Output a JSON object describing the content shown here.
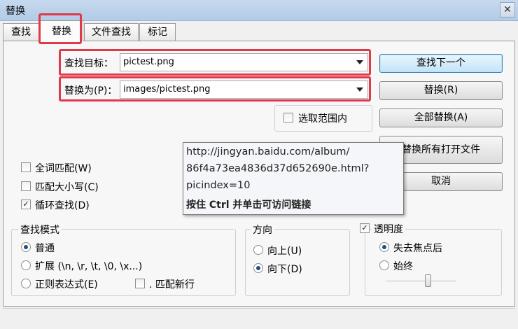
{
  "window": {
    "title": "替换",
    "close_glyph": "✕"
  },
  "tabs": [
    {
      "label": "查找"
    },
    {
      "label": "替换"
    },
    {
      "label": "文件查找"
    },
    {
      "label": "标记"
    }
  ],
  "find": {
    "label": "查找目标：",
    "value": "pictest.png"
  },
  "replace": {
    "label": "替换为(P)：",
    "value": "images/pictest.png"
  },
  "buttons": {
    "find_next": "查找下一个",
    "replace": "替换(R)",
    "replace_all": "全部替换(A)",
    "replace_all_open": "替换所有打开文件",
    "cancel": "取消"
  },
  "options": {
    "in_selection": "选取范围内",
    "whole_word": "全词匹配(W)",
    "match_case": "匹配大小写(C)",
    "wrap": "循环查找(D)",
    "checked_glyph": "✓"
  },
  "search_mode": {
    "title": "查找模式",
    "normal": "普通",
    "extended": "扩展 (\\n, \\r, \\t, \\0, \\x...)",
    "regex": "正则表达式(E)",
    "dot_newline": ". 匹配新行"
  },
  "direction": {
    "title": "方向",
    "up": "向上(U)",
    "down": "向下(D)"
  },
  "transparency": {
    "title": "透明度",
    "on_lose_focus": "失去焦点后",
    "always": "始终",
    "slider_level": 0.6
  },
  "tooltip": {
    "line1": "http://jingyan.baidu.com/album/",
    "line2": "86f4a73ea4836d37d652690e.html?",
    "line3": "picindex=10",
    "line4": "按住 Ctrl 并单击可访问链接"
  },
  "colors": {
    "highlight": "#e0394a",
    "default_button": "#3c7fb1"
  }
}
